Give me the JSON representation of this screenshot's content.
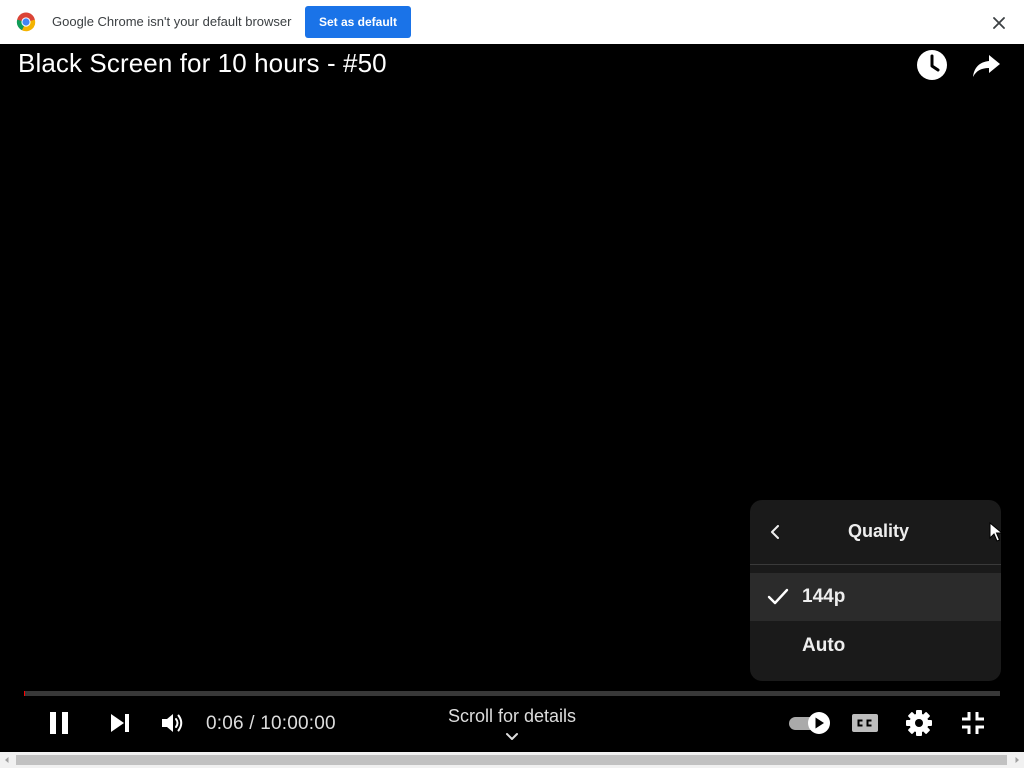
{
  "infobar": {
    "message": "Google Chrome isn't your default browser",
    "set_default_label": "Set as default"
  },
  "video": {
    "title": "Black Screen for 10 hours - #50",
    "progress_fraction": 0.0002
  },
  "quality_menu": {
    "title": "Quality",
    "options": [
      {
        "label": "144p",
        "selected": true
      },
      {
        "label": "Auto",
        "selected": false
      }
    ]
  },
  "controls": {
    "time_display": "0:06 / 10:00:00",
    "scroll_hint": "Scroll for details",
    "autoplay_on": true
  },
  "icons": {
    "chrome": "chrome-logo-icon",
    "close": "close-icon",
    "watch_later": "clock-icon",
    "share": "share-icon",
    "back": "chevron-left-icon",
    "check": "check-icon",
    "pause": "pause-icon",
    "next": "skip-next-icon",
    "volume": "volume-icon",
    "chevron_down": "chevron-down-icon",
    "autoplay": "autoplay-toggle-icon",
    "cc": "closed-captions-icon",
    "settings": "gear-icon",
    "exit_fullscreen": "exit-fullscreen-icon"
  },
  "colors": {
    "accent": "#1a73e8",
    "progress": "#ff0000",
    "panel": "#1c1c1c"
  }
}
